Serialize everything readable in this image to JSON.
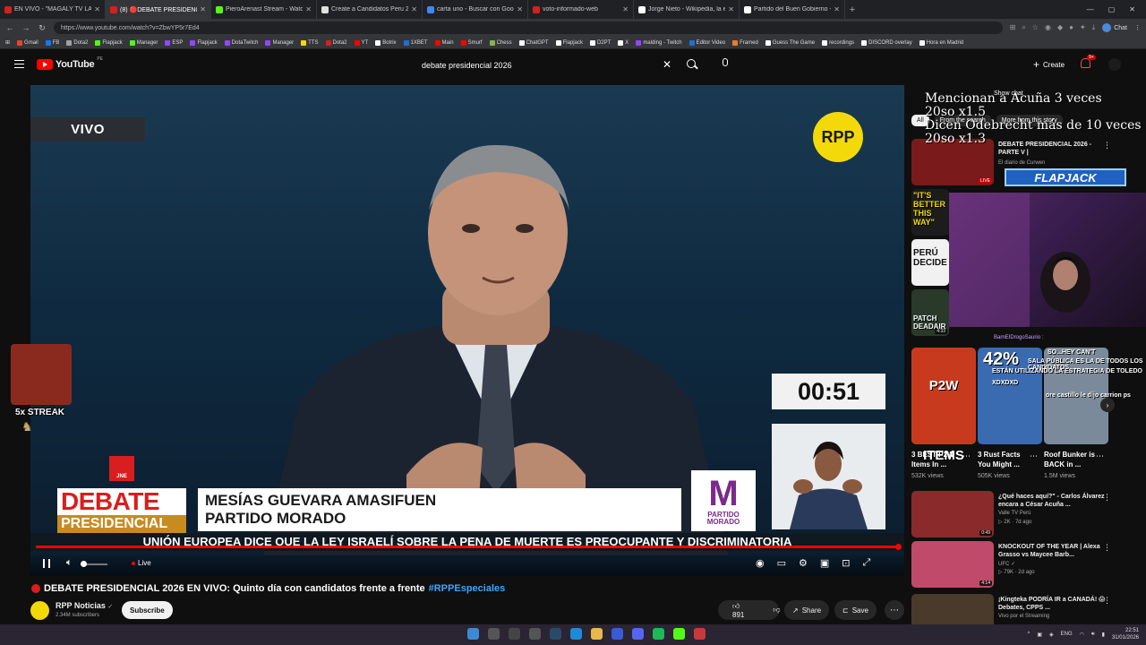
{
  "browser": {
    "tabs": [
      {
        "title": "EN VIVO - \"MAGALY TV LA",
        "color": "#d81e1e"
      },
      {
        "title": "(8) 🔴DEBATE PRESIDENCIAL 2026",
        "color": "#d81e1e"
      },
      {
        "title": "PieroArenast Stream - Watch Live",
        "color": "#53fc18"
      },
      {
        "title": "Create a Candidatos Peru 2026 Tie",
        "color": "#e0e0e0"
      },
      {
        "title": "carta uno - Buscar con Google",
        "color": "#4285f4"
      },
      {
        "title": "voto-informado-web",
        "color": "#d81e1e"
      },
      {
        "title": "Jorge Nieto - Wikipedia, la encicl",
        "color": "#ffffff"
      },
      {
        "title": "Partido del Buen Gobierno - Wikip",
        "color": "#ffffff"
      }
    ],
    "url": "https://www.youtube.com/watch?v=ZbwYP5r7Ed4",
    "chat_label": "Chat",
    "bookmarks": [
      {
        "label": "Gmail",
        "color": "#ea4335"
      },
      {
        "label": "FB",
        "color": "#1877f2"
      },
      {
        "label": "Dota2",
        "color": "#a0a0a0"
      },
      {
        "label": "Flapjack",
        "color": "#53fc18"
      },
      {
        "label": "Manager",
        "color": "#53fc18"
      },
      {
        "label": "ESP",
        "color": "#9146ff"
      },
      {
        "label": "Flapjack",
        "color": "#9146ff"
      },
      {
        "label": "DotaTwitch",
        "color": "#9146ff"
      },
      {
        "label": "Manager",
        "color": "#9146ff"
      },
      {
        "label": "TTS",
        "color": "#f4d90a"
      },
      {
        "label": "Dota2",
        "color": "#d81e1e"
      },
      {
        "label": "YT",
        "color": "#ff0000"
      },
      {
        "label": "Botrix",
        "color": "#ffffff"
      },
      {
        "label": "1XBET",
        "color": "#1e6fd8"
      },
      {
        "label": "Main",
        "color": "#ff0000"
      },
      {
        "label": "Smurf",
        "color": "#ff0000"
      },
      {
        "label": "Chess",
        "color": "#81b64c"
      },
      {
        "label": "ChatGPT",
        "color": "#ffffff"
      },
      {
        "label": "Flapjack",
        "color": "#ffffff"
      },
      {
        "label": "D2PT",
        "color": "#ffffff"
      },
      {
        "label": "X",
        "color": "#ffffff"
      },
      {
        "label": "malding - Twitch",
        "color": "#9146ff"
      },
      {
        "label": "Editor Video",
        "color": "#1e6fd8"
      },
      {
        "label": "Framed",
        "color": "#e08030"
      },
      {
        "label": "Guess The Game",
        "color": "#ffffff"
      },
      {
        "label": "recordings",
        "color": "#ffffff"
      },
      {
        "label": "DISCORD overlay",
        "color": "#ffffff"
      },
      {
        "label": "Hora en Madrid",
        "color": "#ffffff"
      }
    ]
  },
  "yt": {
    "logo": "YouTube",
    "country": "PE",
    "search_value": "debate presidencial 2026",
    "create_label": "Create",
    "notif_count": "9+"
  },
  "player": {
    "vivo": "VIVO",
    "rpp": "RPP",
    "timer": "00:51",
    "jne": "JNE",
    "debate": "DEBATE",
    "presidencial": "PRESIDENCIAL",
    "speaker_name": "MESÍAS GUEVARA AMASIFUEN",
    "speaker_party": "PARTIDO MORADO",
    "party_letter": "M",
    "party_name": "PARTIDO MORADO",
    "ticker": "UNIÓN EUROPEA DICE QUE LA LEY ISRAELÍ SOBRE LA PENA DE MUERTE ES PREOCUPANTE Y DISCRIMINATORIA",
    "live": "Live",
    "progress": 1.0
  },
  "streak": {
    "text": "5x STREAK"
  },
  "video": {
    "title": "DEBATE PRESIDENCIAL 2026 EN VIVO: Quinto día con candidatos frente a frente",
    "hashtag": "#RPPEspeciales",
    "channel": "RPP Noticias",
    "subs": "2.34M subscribers",
    "subscribe": "Subscribe",
    "likes": "891",
    "share": "Share",
    "save": "Save"
  },
  "side": {
    "show_chat": "Show chat",
    "overlay_line1": "Mencionan a Acuña 3 veces",
    "overlay_line2": "20so x1.5",
    "overlay_line3": "Dicen Odebrecht más de 10 veces",
    "overlay_line4": "20so x1.3",
    "chips": [
      "All",
      "From the search",
      "More from this story"
    ],
    "flapjack": "FLAPJACK",
    "chat_user": "BarnEIDrogoSaurio :",
    "recs_top": [
      {
        "title": "DEBATE PRESIDENCIAL 2026 - PARTE V |",
        "channel": "El diario de Curwen",
        "meta": "",
        "color": "#7a1a1a",
        "dur": "LIVE"
      },
      {
        "title": "",
        "channel": "",
        "meta": "",
        "color": "#222222",
        "dur": ""
      },
      {
        "title": "",
        "channel": "",
        "meta": "",
        "color": "#303030",
        "dur": ""
      },
      {
        "title": "",
        "channel": "",
        "meta": "",
        "color": "#2a3a2a",
        "dur": "4:33"
      }
    ],
    "recs_overlay": [
      "\"IT'S BETTER THIS WAY\"",
      "PERÚ DECIDE",
      "PATCH DEADAIR"
    ],
    "shorts": [
      {
        "title": "3 BEST P2W Items In ...",
        "views": "532K views",
        "color": "#c83a1e",
        "overlay": "P2W ITEMS"
      },
      {
        "title": "3 Rust Facts You Might ...",
        "views": "505K views",
        "color": "#3a6ab0",
        "overlay": "42%"
      },
      {
        "title": "Roof Bunker is BACK in ...",
        "views": "1.5M views",
        "color": "#7a8a9a",
        "overlay": "SO...HEY CAN'T"
      }
    ],
    "shorts_chat_1": "SALA PÚBLICA ES LA DE TODOS LOS CANDIDATOS",
    "shorts_chat_2": "ESTÁN UTILIZANDO LA ESTRATEGIA DE TOLEDO",
    "shorts_chat_3": "XDXDXD",
    "shorts_chat_4": "ore castillo le dijo carrion ps",
    "recs_bottom": [
      {
        "title": "¿Qué haces aquí?\" - Carlos Álvarez encara a César Acuña ...",
        "channel": "Valle TV Perú",
        "meta": "▷ 2K · 7d ago",
        "color": "#8a2a2a",
        "dur": "0:49"
      },
      {
        "title": "KNOCKOUT OF THE YEAR | Alexa Grasso vs Maycee Barb...",
        "channel": "UFC ✓",
        "meta": "▷ 79K · 2d ago",
        "color": "#c04a6a",
        "dur": "4:14"
      },
      {
        "title": "¡Kingteka PODRÍA IR a CANADÁ! 😱 Debates, CPPS ...",
        "channel": "Vivo por el Streaming",
        "meta": "",
        "color": "#4a3a2a",
        "dur": ""
      }
    ]
  },
  "taskbar": {
    "lang": "ENG",
    "time": "22:51",
    "date": "31/01/2026"
  }
}
